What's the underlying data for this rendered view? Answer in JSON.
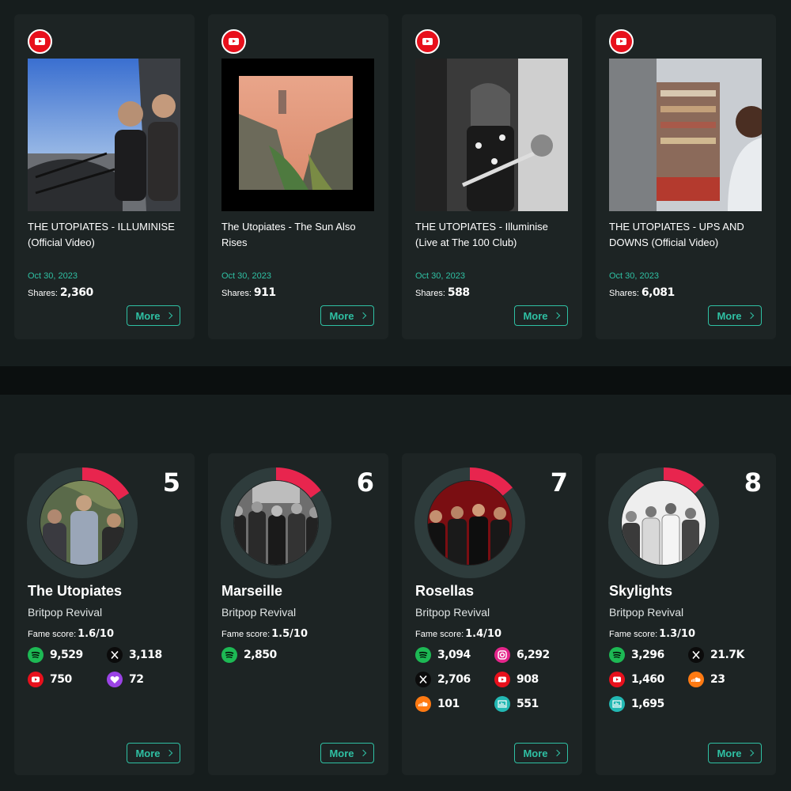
{
  "videos": [
    {
      "title": "THE UTOPIATES - ILLUMINISE (Official Video)",
      "date": "Oct 30, 2023",
      "shares_label": "Shares:",
      "shares": "2,360",
      "more": "More",
      "platform_icon": "youtube-icon"
    },
    {
      "title": "The Utopiates - The Sun Also Rises",
      "date": "Oct 30, 2023",
      "shares_label": "Shares:",
      "shares": "911",
      "more": "More",
      "platform_icon": "youtube-icon"
    },
    {
      "title": "THE UTOPIATES - Illuminise (Live at The 100 Club)",
      "date": "Oct 30, 2023",
      "shares_label": "Shares:",
      "shares": "588",
      "more": "More",
      "platform_icon": "youtube-icon"
    },
    {
      "title": "THE UTOPIATES - UPS AND DOWNS (Official Video)",
      "date": "Oct 30, 2023",
      "shares_label": "Shares:",
      "shares": "6,081",
      "more": "More",
      "platform_icon": "youtube-icon"
    }
  ],
  "artists": [
    {
      "rank": "5",
      "name": "The Utopiates",
      "genre": "Britpop Revival",
      "fame_label": "Fame score:",
      "fame": "1.6/10",
      "fame_fraction": 0.16,
      "more": "More",
      "stats": [
        {
          "platform": "spotify",
          "icon": "spotify-icon",
          "value": "9,529"
        },
        {
          "platform": "x",
          "icon": "x-icon",
          "value": "3,118"
        },
        {
          "platform": "youtube",
          "icon": "youtube-icon",
          "value": "750"
        },
        {
          "platform": "heart",
          "icon": "heart-icon",
          "value": "72"
        }
      ]
    },
    {
      "rank": "6",
      "name": "Marseille",
      "genre": "Britpop Revival",
      "fame_label": "Fame score:",
      "fame": "1.5/10",
      "fame_fraction": 0.15,
      "more": "More",
      "stats": [
        {
          "platform": "spotify",
          "icon": "spotify-icon",
          "value": "2,850"
        }
      ]
    },
    {
      "rank": "7",
      "name": "Rosellas",
      "genre": "Britpop Revival",
      "fame_label": "Fame score:",
      "fame": "1.4/10",
      "fame_fraction": 0.14,
      "more": "More",
      "stats": [
        {
          "platform": "spotify",
          "icon": "spotify-icon",
          "value": "3,094"
        },
        {
          "platform": "instagram",
          "icon": "instagram-icon",
          "value": "6,292"
        },
        {
          "platform": "x",
          "icon": "x-icon",
          "value": "2,706"
        },
        {
          "platform": "youtube",
          "icon": "youtube-icon",
          "value": "908"
        },
        {
          "platform": "soundcloud",
          "icon": "soundcloud-icon",
          "value": "101"
        },
        {
          "platform": "deezer",
          "icon": "deezer-icon",
          "value": "551"
        }
      ]
    },
    {
      "rank": "8",
      "name": "Skylights",
      "genre": "Britpop Revival",
      "fame_label": "Fame score:",
      "fame": "1.3/10",
      "fame_fraction": 0.13,
      "more": "More",
      "stats": [
        {
          "platform": "spotify",
          "icon": "spotify-icon",
          "value": "3,296"
        },
        {
          "platform": "x",
          "icon": "x-icon",
          "value": "21.7K"
        },
        {
          "platform": "youtube",
          "icon": "youtube-icon",
          "value": "1,460"
        },
        {
          "platform": "soundcloud",
          "icon": "soundcloud-icon",
          "value": "23"
        },
        {
          "platform": "deezer",
          "icon": "deezer-icon",
          "value": "1,695"
        }
      ]
    }
  ],
  "colors": {
    "accent": "#2fc0a3",
    "ring_fill": "#e8254e",
    "ring_track": "#2e3c3c",
    "card": "#1d2424",
    "youtube": "#e8101c"
  }
}
